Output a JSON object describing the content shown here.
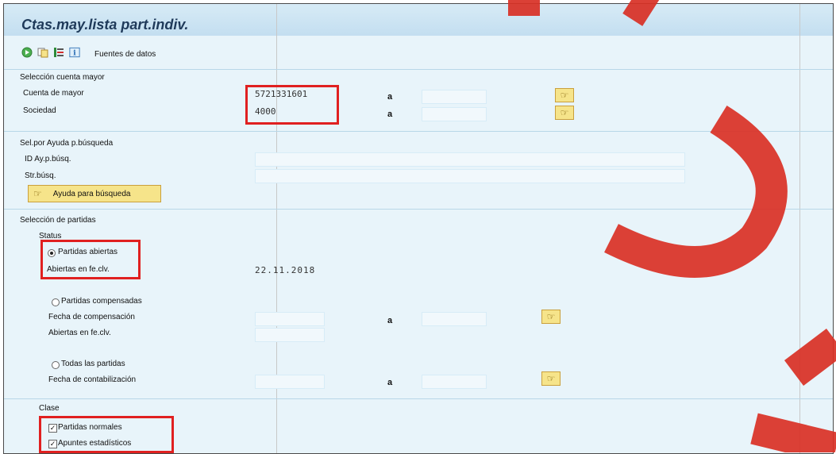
{
  "title": "Ctas.may.lista part.indiv.",
  "toolbar": {
    "data_sources_label": "Fuentes de datos"
  },
  "account_selection": {
    "section_label": "Selección cuenta mayor",
    "gl_account_label": "Cuenta de mayor",
    "gl_account_value": "5721331601",
    "company_label": "Sociedad",
    "company_value": "4000",
    "to_label": "a"
  },
  "search_help": {
    "section_label": "Sel.por Ayuda p.búsqueda",
    "id_label": "ID Ay.p.búsq.",
    "string_label": "Str.búsq.",
    "button_label": "Ayuda para búsqueda"
  },
  "item_selection": {
    "section_label": "Selección de partidas",
    "status_label": "Status",
    "open_items_label": "Partidas abiertas",
    "open_at_key_date_label": "Abiertas en fe.clv.",
    "open_at_key_date_value": "22.11.2018",
    "cleared_items_label": "Partidas compensadas",
    "clearing_date_label": "Fecha de compensación",
    "cleared_open_at_key_date_label": "Abiertas en fe.clv.",
    "all_items_label": "Todas las partidas",
    "posting_date_label": "Fecha de contabilización",
    "to_label": "a"
  },
  "type": {
    "section_label": "Clase",
    "normal_items_label": "Partidas normales",
    "statistical_items_label": "Apuntes estadísticos"
  },
  "colors": {
    "highlight": "#e02020",
    "background": "#e8f4fa"
  }
}
